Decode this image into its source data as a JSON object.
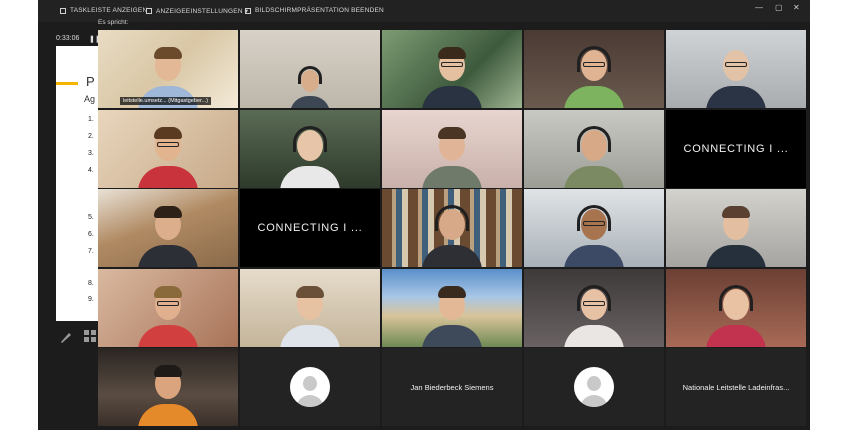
{
  "toolbar": {
    "show_taskbar": "TASKLEISTE ANZEIGEN",
    "view_options": "ANZEIGEEINSTELLUNGEN ▾",
    "stop_share": "BILDSCHIRMPRÄSENTATION BEENDEN",
    "win_min": "—",
    "win_max": "▢",
    "win_close": "✕"
  },
  "speaking_label": "Es spricht:",
  "timer": "0:33:06",
  "pause_icon": "pause-icon",
  "slide": {
    "title": "P",
    "subtitle": "Ag",
    "numbers": [
      "1.",
      "2.",
      "3.",
      "4.",
      "5.",
      "6.",
      "7.",
      "8.",
      "9."
    ]
  },
  "tiles": {
    "active_name": "leitstelle.umsetz... (Mitgastgeber...)",
    "connecting_1": "CONNECTING I ...",
    "connecting_2": "CONNECTING I ...",
    "name_1": "Jan Biederbeck Siemens",
    "name_2": "Nationale Leitstelle Ladeinfras..."
  },
  "colors": {
    "active_border": "#3aa6ff",
    "accent_bar": "#f4b400"
  }
}
